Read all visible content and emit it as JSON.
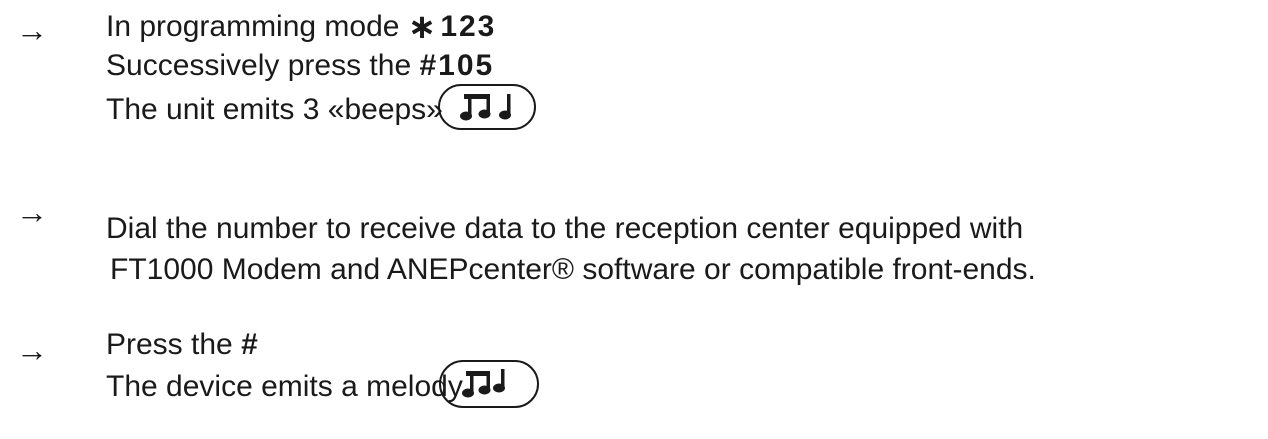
{
  "instructions": [
    {
      "arrow": "→",
      "lines": [
        {
          "text": "In programming mode ",
          "code": "123",
          "code_prefix": "∗"
        },
        {
          "text": "Successively press the ",
          "code": "#105"
        },
        {
          "text": "The unit emits 3 «beeps»"
        }
      ],
      "badge_icon": "three-beeps-music-icon"
    },
    {
      "arrow": "→",
      "lines": [
        {
          "text": "Dial the number to receive data to the reception center equipped with"
        },
        {
          "text": "FT1000 Modem and ANEPcenter® software or compatible front-ends."
        }
      ]
    },
    {
      "arrow": "→",
      "lines": [
        {
          "text": "Press the ",
          "code": "#"
        },
        {
          "text": "The device emits a melody"
        }
      ],
      "badge_icon": "melody-music-icon"
    }
  ],
  "colors": {
    "text": "#1a1a1a",
    "background": "#ffffff"
  }
}
